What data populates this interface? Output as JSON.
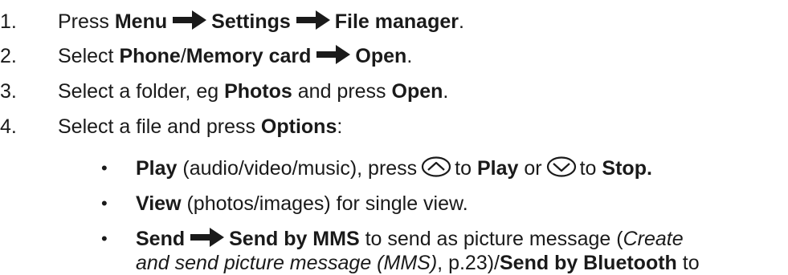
{
  "steps": [
    {
      "num": "1.",
      "p0": "Press ",
      "b0": "Menu",
      "b1": "Settings",
      "b2": "File manager",
      "p1": "."
    },
    {
      "num": "2.",
      "p0": "Select ",
      "b0": "Phone",
      "p1": "/",
      "b1": "Memory card",
      "b2": "Open",
      "p2": "."
    },
    {
      "num": "3.",
      "p0": "Select a folder, eg ",
      "b0": "Photos",
      "p1": " and press ",
      "b1": "Open",
      "p2": "."
    },
    {
      "num": "4.",
      "p0": "Select a file and press ",
      "b0": "Options",
      "p1": ":"
    }
  ],
  "options": {
    "bullet": "•",
    "play": {
      "b0": "Play",
      "p0": " (audio/video/music), press",
      "p1": "to",
      "b1": "Play",
      "p2": "or",
      "p3": "to",
      "b2": "Stop."
    },
    "view": {
      "b0": "View",
      "p0": " (photos/images) for single view."
    },
    "send": {
      "b0": "Send",
      "b1": "Send by MMS",
      "p0": " to send as picture message (",
      "i0": "Create",
      "i1": "and send picture message (MMS)",
      "p1": ", p.23)/",
      "b2": "Send by Bluetooth",
      "p2": " to"
    }
  },
  "icons": {
    "arrow": "right-arrow-icon",
    "up_key": "up-navigation-key-icon",
    "down_key": "down-navigation-key-icon"
  }
}
